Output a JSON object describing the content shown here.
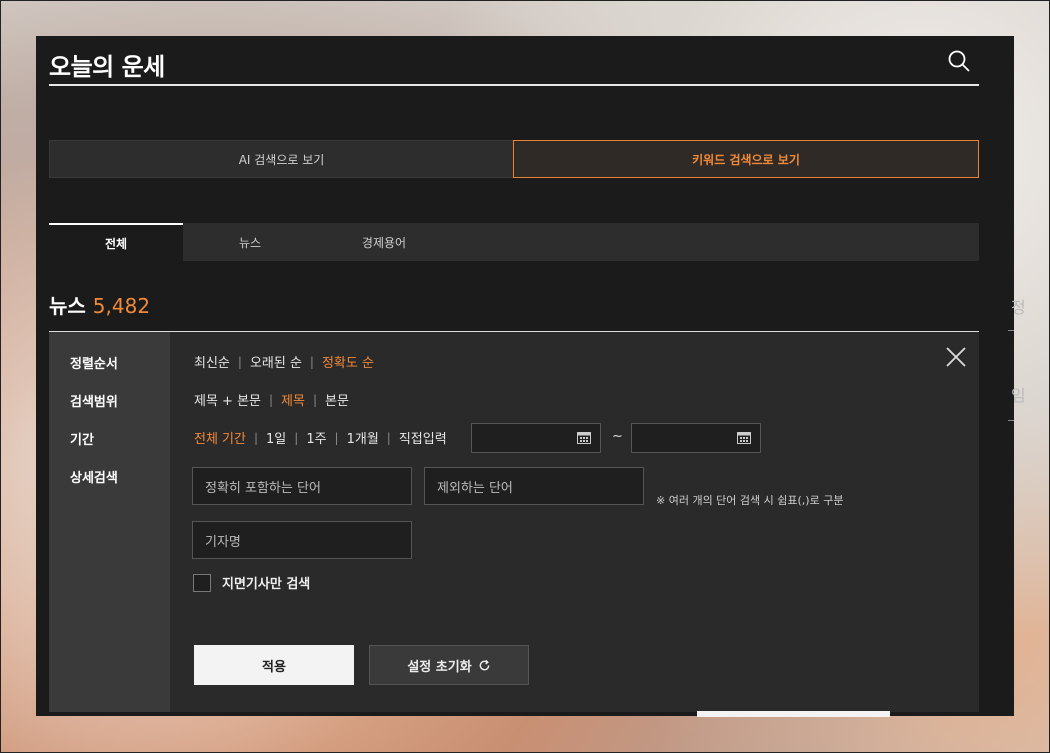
{
  "header": {
    "title": "오늘의 운세"
  },
  "mode": {
    "ai_label": "AI 검색으로 보기",
    "keyword_label": "키워드 검색으로 보기"
  },
  "tabs": [
    {
      "label": "전체",
      "active": true
    },
    {
      "label": "뉴스",
      "active": false
    },
    {
      "label": "경제용어",
      "active": false
    }
  ],
  "result": {
    "label": "뉴스",
    "count": "5,482"
  },
  "side": {
    "char1": "정",
    "char2": "임"
  },
  "filter": {
    "labels": {
      "sort": "정렬순서",
      "scope": "검색범위",
      "period": "기간",
      "detail": "상세검색"
    },
    "sort_options": [
      {
        "label": "최신순"
      },
      {
        "label": "오래된 순"
      },
      {
        "label": "정확도 순",
        "selected": true
      }
    ],
    "scope_options": [
      {
        "label": "제목 + 본문"
      },
      {
        "label": "제목",
        "selected": true
      },
      {
        "label": "본문"
      }
    ],
    "period_options": [
      {
        "label": "전체 기간",
        "selected": true
      },
      {
        "label": "1일"
      },
      {
        "label": "1주"
      },
      {
        "label": "1개월"
      },
      {
        "label": "직접입력"
      }
    ],
    "date_sep": "~",
    "exact_placeholder": "정확히 포함하는 단어",
    "exclude_placeholder": "제외하는 단어",
    "note": "※ 여러 개의 단어 검색 시 쉼표(,)로 구분",
    "reporter_placeholder": "기자명",
    "print_only_label": "지면기사만 검색",
    "apply_label": "적용",
    "reset_label": "설정 초기화"
  },
  "colors": {
    "accent": "#f08a3a",
    "panel": "#1b1b1b"
  }
}
